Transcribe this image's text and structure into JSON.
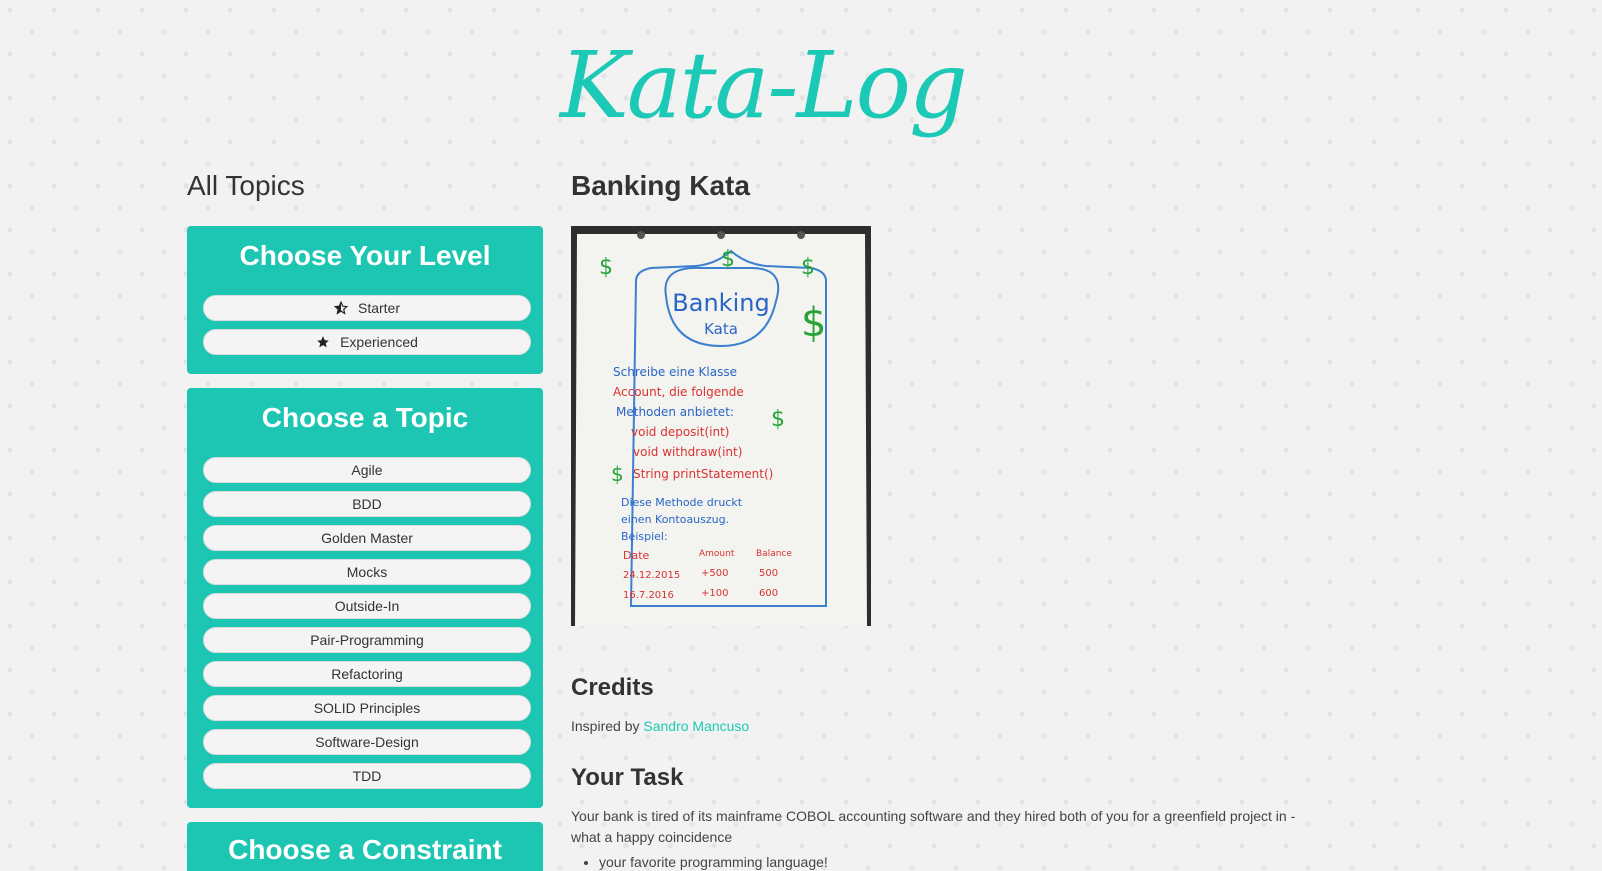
{
  "brand": {
    "title": "Kata-Log",
    "color": "#1cc9b6"
  },
  "sidebar": {
    "heading": "All Topics",
    "level_panel": {
      "title": "Choose Your Level",
      "options": [
        {
          "label": "Starter",
          "icon": "half-star-icon"
        },
        {
          "label": "Experienced",
          "icon": "star-icon"
        }
      ]
    },
    "topic_panel": {
      "title": "Choose a Topic",
      "options": [
        "Agile",
        "BDD",
        "Golden Master",
        "Mocks",
        "Outside-In",
        "Pair-Programming",
        "Refactoring",
        "SOLID Principles",
        "Software-Design",
        "TDD"
      ]
    },
    "constraint_panel": {
      "title": "Choose a Constraint"
    },
    "panel_color": "#1dc6b3"
  },
  "main": {
    "title": "Banking Kata",
    "image": {
      "heading": "Banking",
      "subheading": "Kata",
      "lines": [
        "Schreibe eine Klasse",
        "Account, die folgende",
        "Methoden anbietet:",
        "void deposit(int)",
        "void withdraw(int)",
        "String printStatement()",
        "Diese Methode druckt",
        "einen Kontoauszug.",
        "Beispiel:"
      ],
      "table_headers": [
        "Date",
        "Amount",
        "Balance"
      ],
      "table_rows": [
        [
          "24.12.2015",
          "+500",
          "500"
        ],
        [
          "16.7.2016",
          "+100",
          "600"
        ]
      ],
      "dollar": "$"
    },
    "credits": {
      "title": "Credits",
      "prefix": "Inspired by",
      "author": "Sandro Mancuso"
    },
    "task": {
      "title": "Your Task",
      "text": "Your bank is tired of its mainframe COBOL accounting software and they hired both of you for a greenfield project in - what a happy coincidence",
      "list_item": "your favorite programming language!"
    }
  }
}
